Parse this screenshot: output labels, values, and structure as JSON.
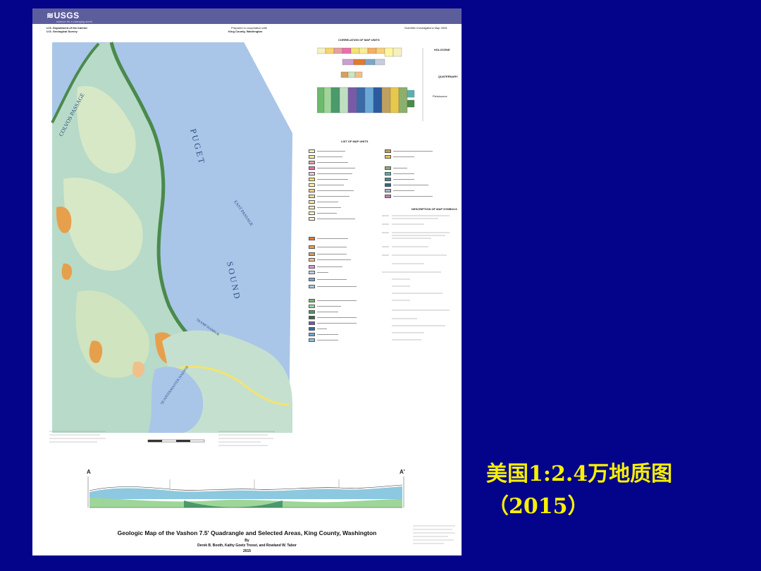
{
  "header": {
    "agency": "USGS",
    "tagline": "science for a changing world",
    "department": "U.S. Department of the Interior",
    "survey": "U.S. Geological Survey",
    "prepared": "Prepared in cooperation with",
    "cooperator": "King County, Washington",
    "series": "Scientific Investigations Map 3328"
  },
  "map": {
    "labels": {
      "colvos": "COLVOS PASSAGE",
      "puget": "P U G E T",
      "sound": "S O U N D",
      "east_passage": "EAST PASSAGE",
      "tramp_harbor": "TRAMP HARBOR",
      "quartermaster": "QUARTERMASTER HARBOR"
    },
    "colors": {
      "water": "#a9c6e8",
      "upland": "#b8dac8",
      "till": "#d7e8c7",
      "outwash": "#e6a04c",
      "landslide": "#4a8a4c",
      "beach": "#f2e46f"
    }
  },
  "legend": {
    "correlation_title": "CORRELATION OF MAP UNITS",
    "list_title": "LIST OF MAP UNITS",
    "symbols_title": "DESCRIPTION OF MAP SYMBOLS",
    "holocene": "HOLOCENE",
    "quaternary": "QUATERNARY",
    "pleistocene": "Pleistocene"
  },
  "section": {
    "left_label": "A",
    "right_label": "A'"
  },
  "footer": {
    "title": "Geologic Map of the Vashon 7.5' Quadrangle and Selected Areas, King County, Washington",
    "by": "By",
    "authors": "Derek B. Booth, Kathy Goetz Troost, and Rowland W. Tabor",
    "year": "2015"
  },
  "caption": {
    "line1": "美国1:2.4万地质图",
    "line2": "（2015）"
  }
}
